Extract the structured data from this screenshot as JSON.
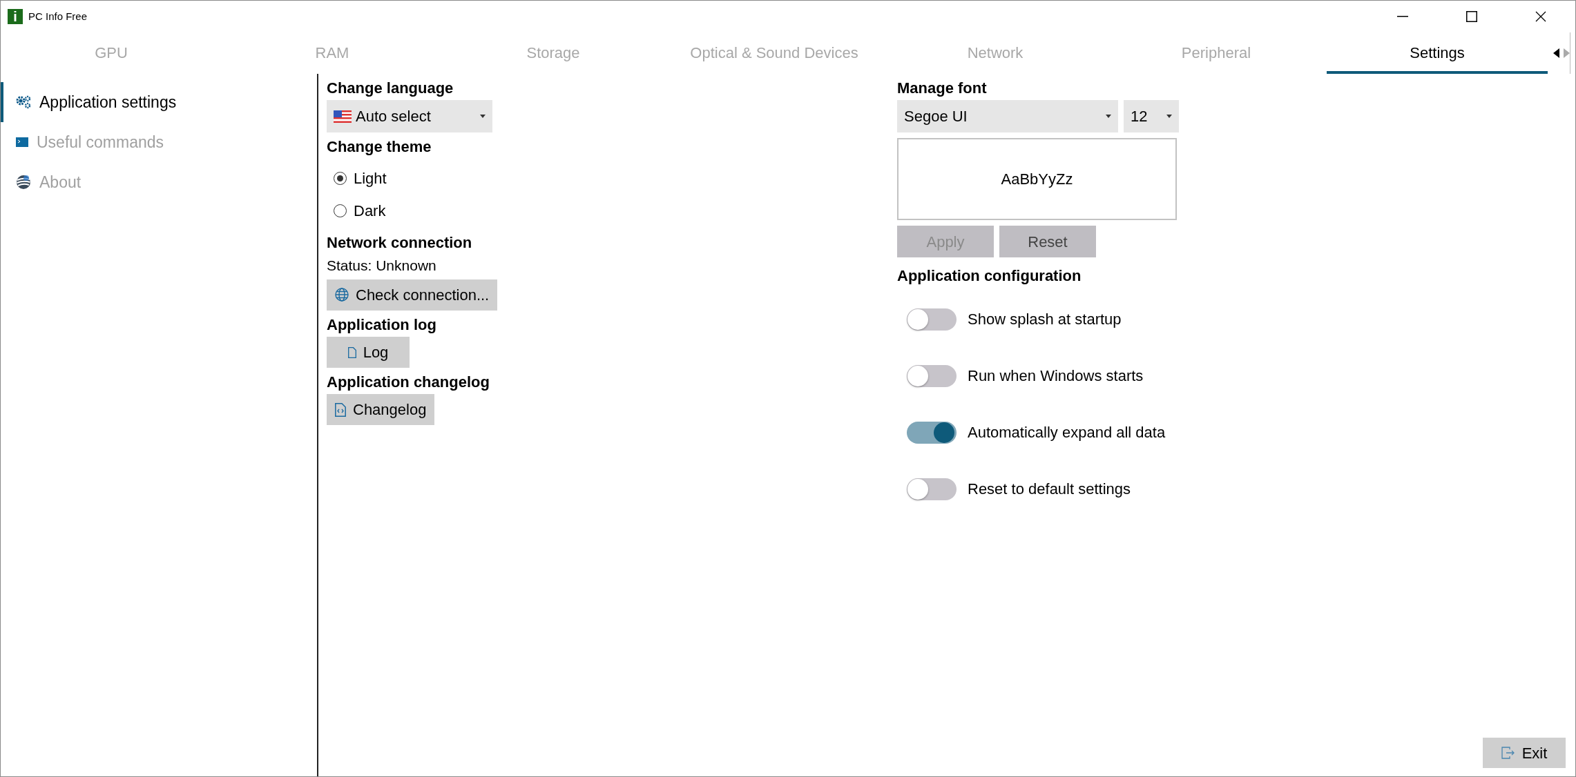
{
  "window": {
    "logo_letter": "i",
    "title": "PC Info Free"
  },
  "tabs": [
    {
      "label": "GPU",
      "selected": false
    },
    {
      "label": "RAM",
      "selected": false
    },
    {
      "label": "Storage",
      "selected": false
    },
    {
      "label": "Optical & Sound Devices",
      "selected": false
    },
    {
      "label": "Network",
      "selected": false
    },
    {
      "label": "Peripheral",
      "selected": false
    },
    {
      "label": "Settings",
      "selected": true
    }
  ],
  "sidebar": {
    "items": [
      {
        "kind": "gears",
        "label": "Application settings",
        "selected": true
      },
      {
        "kind": "terminal",
        "label": "Useful commands",
        "selected": false
      },
      {
        "kind": "sphere",
        "label": "About",
        "selected": false
      }
    ]
  },
  "language": {
    "heading": "Change language",
    "value": "Auto select"
  },
  "theme": {
    "heading": "Change theme",
    "options": [
      {
        "label": "Light",
        "selected": true
      },
      {
        "label": "Dark",
        "selected": false
      }
    ]
  },
  "network": {
    "heading": "Network connection",
    "status": "Status: Unknown",
    "button": "Check connection..."
  },
  "log": {
    "heading": "Application log",
    "button": "Log"
  },
  "changelog": {
    "heading": "Application changelog",
    "button": "Changelog"
  },
  "font": {
    "heading": "Manage font",
    "family": "Segoe UI",
    "size": "12",
    "preview": "AaBbYyZz",
    "buttons": [
      {
        "label": "Apply",
        "disabled": true
      },
      {
        "label": "Reset",
        "disabled": false
      }
    ]
  },
  "configuration": {
    "heading": "Application configuration",
    "toggles": [
      {
        "label": "Show splash at startup",
        "on": false
      },
      {
        "label": "Run when Windows starts",
        "on": false
      },
      {
        "label": "Automatically expand all data",
        "on": true
      },
      {
        "label": "Reset to default settings",
        "on": false
      }
    ]
  },
  "exit_button": "Exit"
}
